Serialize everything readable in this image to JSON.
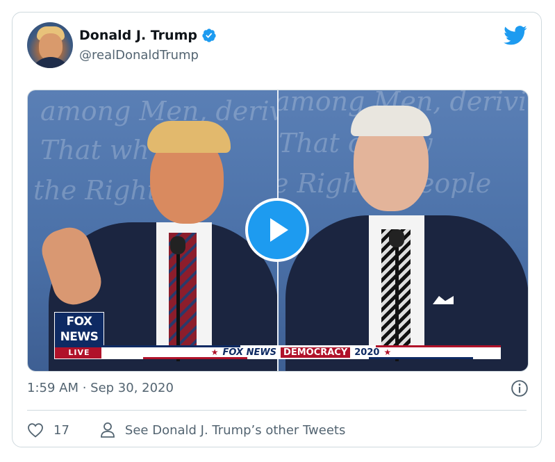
{
  "tweet": {
    "display_name": "Donald J. Trump",
    "handle": "@realDonaldTrump",
    "timestamp": "1:59 AM · Sep 30, 2020",
    "like_count": "17",
    "other_tweets_label": "See Donald J. Trump’s other Tweets"
  },
  "media": {
    "backdrop_text": [
      "among Men, deriv",
      "That wh    any",
      "the Right    Peo",
      "among Men, deriving",
      "That    or any",
      "e Right    e People"
    ],
    "network_logo_top": "FOX",
    "network_logo_mid": "NEWS",
    "network_logo_live": "LIVE",
    "lower_third_brand": "FOX NEWS",
    "lower_third_event": "DEMOCRACY",
    "lower_third_year": "2020"
  },
  "icons": {
    "verified": "verified-badge-icon",
    "twitter": "twitter-bird-icon",
    "play": "play-icon",
    "info": "info-icon",
    "like": "heart-icon",
    "profile": "person-icon"
  },
  "colors": {
    "accent": "#1d9bf0",
    "text_primary": "#0f1419",
    "text_secondary": "#536471",
    "border": "#cfd9de",
    "fox_blue": "#0e2a63",
    "fox_red": "#b0122a"
  }
}
